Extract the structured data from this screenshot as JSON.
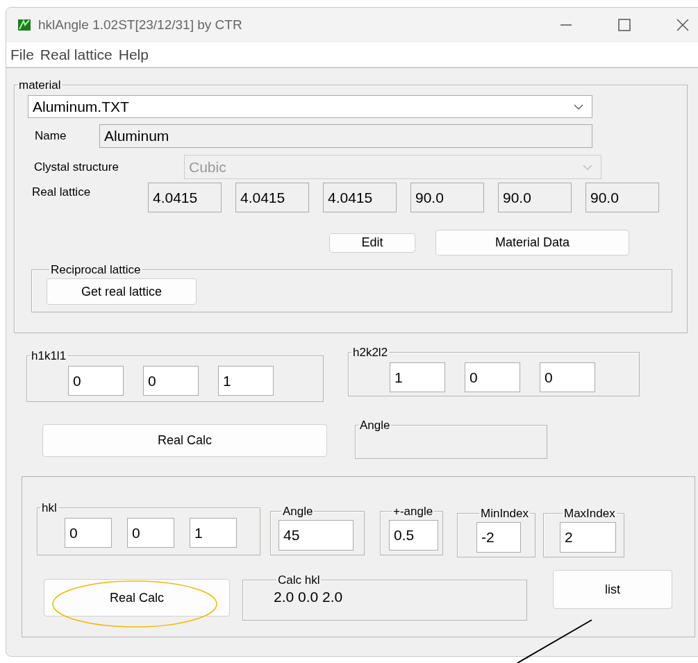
{
  "window": {
    "title": "hklAngle 1.02ST[23/12/31] by CTR"
  },
  "menu": [
    "File",
    "Real lattice",
    "Help"
  ],
  "material": {
    "label": "material",
    "file": "Aluminum.TXT",
    "name_label": "Name",
    "name": "Aluminum",
    "structure_label": "Clystal structure",
    "structure": "Cubic",
    "structure_disabled": true,
    "lattice_label": "Real lattice",
    "lattice": [
      "4.0415",
      "4.0415",
      "4.0415",
      "90.0",
      "90.0",
      "90.0"
    ],
    "edit_button": "Edit",
    "data_button": "Material Data",
    "reciprocal": {
      "label": "Reciprocal lattice",
      "button": "Get real lattice"
    }
  },
  "h1k1l1": {
    "label": "h1k1l1",
    "values": [
      "0",
      "0",
      "1"
    ]
  },
  "h2k2l2": {
    "label": "h2k2l2",
    "values": [
      "1",
      "0",
      "0"
    ]
  },
  "real_calc_button": "Real Calc",
  "angle_result": {
    "label": "Angle"
  },
  "search": {
    "hkl": {
      "label": "hkl",
      "values": [
        "0",
        "0",
        "1"
      ]
    },
    "params": [
      {
        "label": "Angle",
        "value": "45"
      },
      {
        "label": "+-angle",
        "value": "0.5"
      },
      {
        "label": "MinIndex",
        "value": "-2"
      },
      {
        "label": "MaxIndex",
        "value": "2"
      }
    ],
    "calc_button": "Real Calc",
    "calc_hkl": {
      "label": "Calc hkl",
      "value": "2.0 0.0 2.0"
    },
    "list_button": "list"
  },
  "annotations": [
    {
      "kind": "ellipse"
    },
    {
      "kind": "arrow"
    }
  ]
}
